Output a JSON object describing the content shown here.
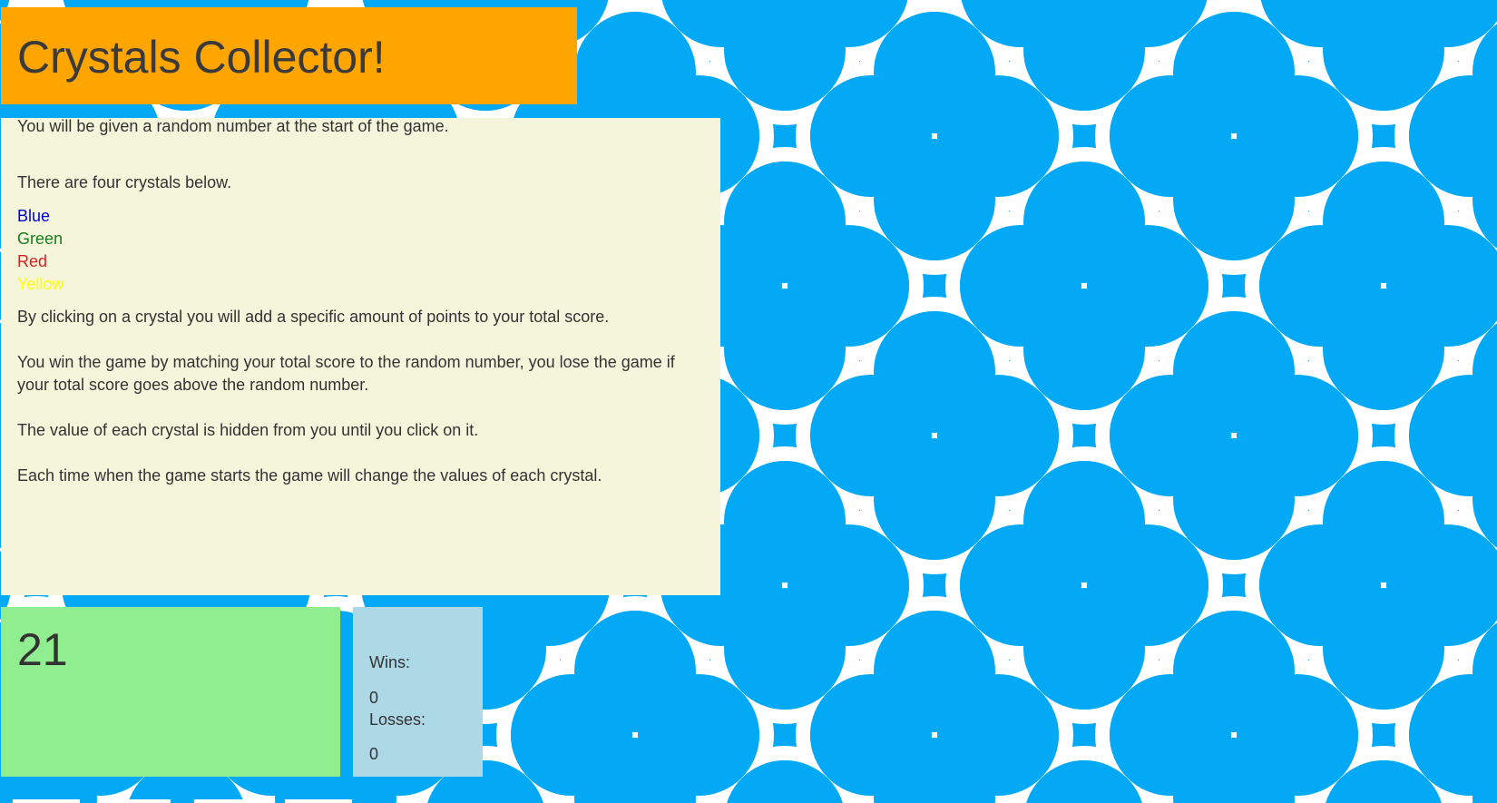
{
  "title": "Crystals Collector!",
  "instructions": {
    "intro": "You will be given a random number at the start of the game.",
    "four_crystals": "There are four crystals below.",
    "colors": [
      "Blue",
      "Green",
      "Red",
      "Yellow"
    ],
    "rules": [
      "By clicking on a crystal you will add a specific amount of points to your total score.",
      "You win the game by matching your total score to the random number, you lose the game if your total score goes above the random number.",
      "The value of each crystal is hidden from you until you click on it.",
      "Each time when the game starts the game will change the values of each crystal."
    ]
  },
  "target_number": "21",
  "scoreboard": {
    "wins_label": "Wins:",
    "wins": "0",
    "losses_label": "Losses:",
    "losses": "0"
  },
  "theme": {
    "background": "#03a9f4",
    "pattern": "#ffffff",
    "title_bg": "#ffa500",
    "instructions_bg": "#f5f5dc",
    "target_bg": "#90ee90",
    "score_bg": "#add8e6"
  }
}
